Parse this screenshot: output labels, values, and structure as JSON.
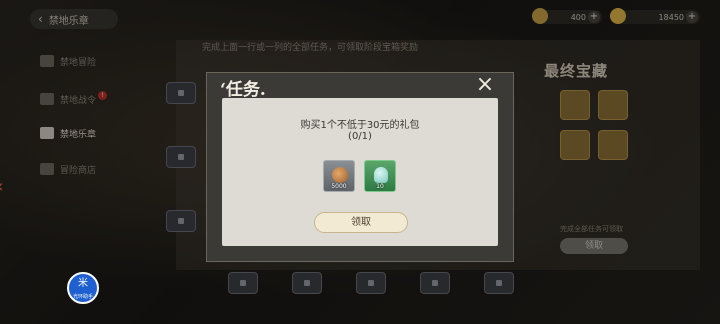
{
  "header": {
    "back_label": "禁地乐章",
    "resources": [
      {
        "icon": "coin-bag-icon",
        "value": "400"
      },
      {
        "icon": "gold-coin-icon",
        "value": "18450"
      }
    ]
  },
  "sidebar": {
    "items": [
      {
        "label": "禁地冒险",
        "icon": "map-icon",
        "active": false
      },
      {
        "label": "禁地战令",
        "icon": "flag-icon",
        "active": false,
        "badge": "!"
      },
      {
        "label": "禁地乐章",
        "icon": "star-icon",
        "active": true
      },
      {
        "label": "冒险商店",
        "icon": "shop-icon",
        "active": false
      }
    ]
  },
  "board": {
    "hint": "完成上面一行或一列的全部任务，可领取阶段宝箱奖励"
  },
  "final_reward": {
    "title": "最终宝藏",
    "hint": "完成全部任务可领取",
    "claim_label": "领取"
  },
  "modal": {
    "title": "‘任务.",
    "task_description": "购买1个不低于30元的礼包",
    "progress": "(0/1)",
    "rewards": [
      {
        "icon": "coin-icon",
        "count": "5000"
      },
      {
        "icon": "gem-icon",
        "count": "10"
      }
    ],
    "claim_label": "领取"
  },
  "overlay_logo": {
    "glyph": "米",
    "caption": "光环助手"
  },
  "colors": {
    "modal_body": "#dedbd5",
    "claim_button": "#f3ead4",
    "badge": "#c0302b"
  }
}
